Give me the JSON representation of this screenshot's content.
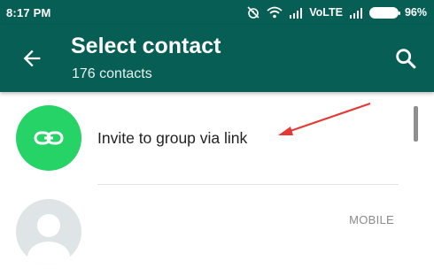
{
  "status_bar": {
    "time": "8:17 PM",
    "network": "VoLTE",
    "battery": "96%",
    "icons": [
      "alarm-off-icon",
      "wifi-icon",
      "signal-icon",
      "signal-icon",
      "battery-icon"
    ]
  },
  "app_bar": {
    "title": "Select contact",
    "subtitle": "176 contacts",
    "back_icon": "arrow-back-icon",
    "search_icon": "search-icon"
  },
  "invite_row": {
    "label": "Invite to group via link",
    "icon": "link-icon"
  },
  "contact_row": {
    "type_label": "MOBILE",
    "avatar_icon": "default-avatar-icon"
  },
  "colors": {
    "header": "#075e54",
    "accent_green": "#25d366",
    "annotation_red": "#e53935"
  }
}
